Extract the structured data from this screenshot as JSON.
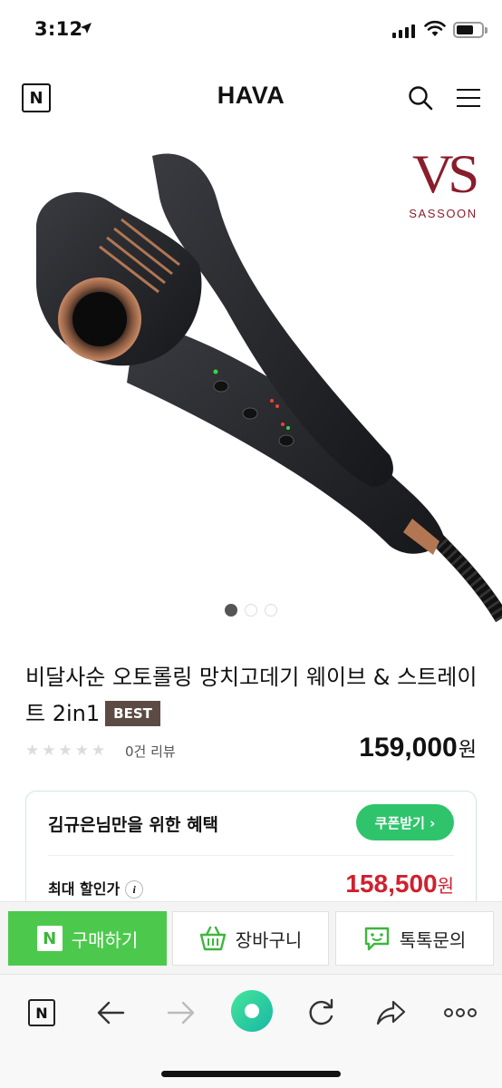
{
  "status": {
    "time": "3:12"
  },
  "header": {
    "logo": "N",
    "brand": "HAVA"
  },
  "hero": {
    "brand_mark": "VS",
    "brand_sub": "SASSOON",
    "slides": 3,
    "active_slide": 1
  },
  "product": {
    "title": "비달사순 오토롤링 망치고데기 웨이브 & 스트레이트 2in1",
    "badge": "BEST",
    "stars": "★★★★★",
    "reviews": "0건 리뷰",
    "price": "159,000",
    "currency": "원"
  },
  "benefit": {
    "title": "김규은님만을 위한 혜택",
    "coupon_label": "쿠폰받기 ›",
    "max_label": "최대 할인가",
    "info": "i",
    "max_price": "158,500",
    "currency": "원"
  },
  "actions": {
    "buy_icon": "N",
    "buy_label": "구매하기",
    "cart_label": "장바구니",
    "talk_label": "톡톡문의"
  },
  "toolbar": {
    "logo": "N"
  },
  "colors": {
    "accent_green": "#4cc94c",
    "coupon_green": "#2fc46b",
    "price_red": "#d0202e",
    "brand_red": "#8a1d2b",
    "badge_brown": "#5b4b44"
  }
}
